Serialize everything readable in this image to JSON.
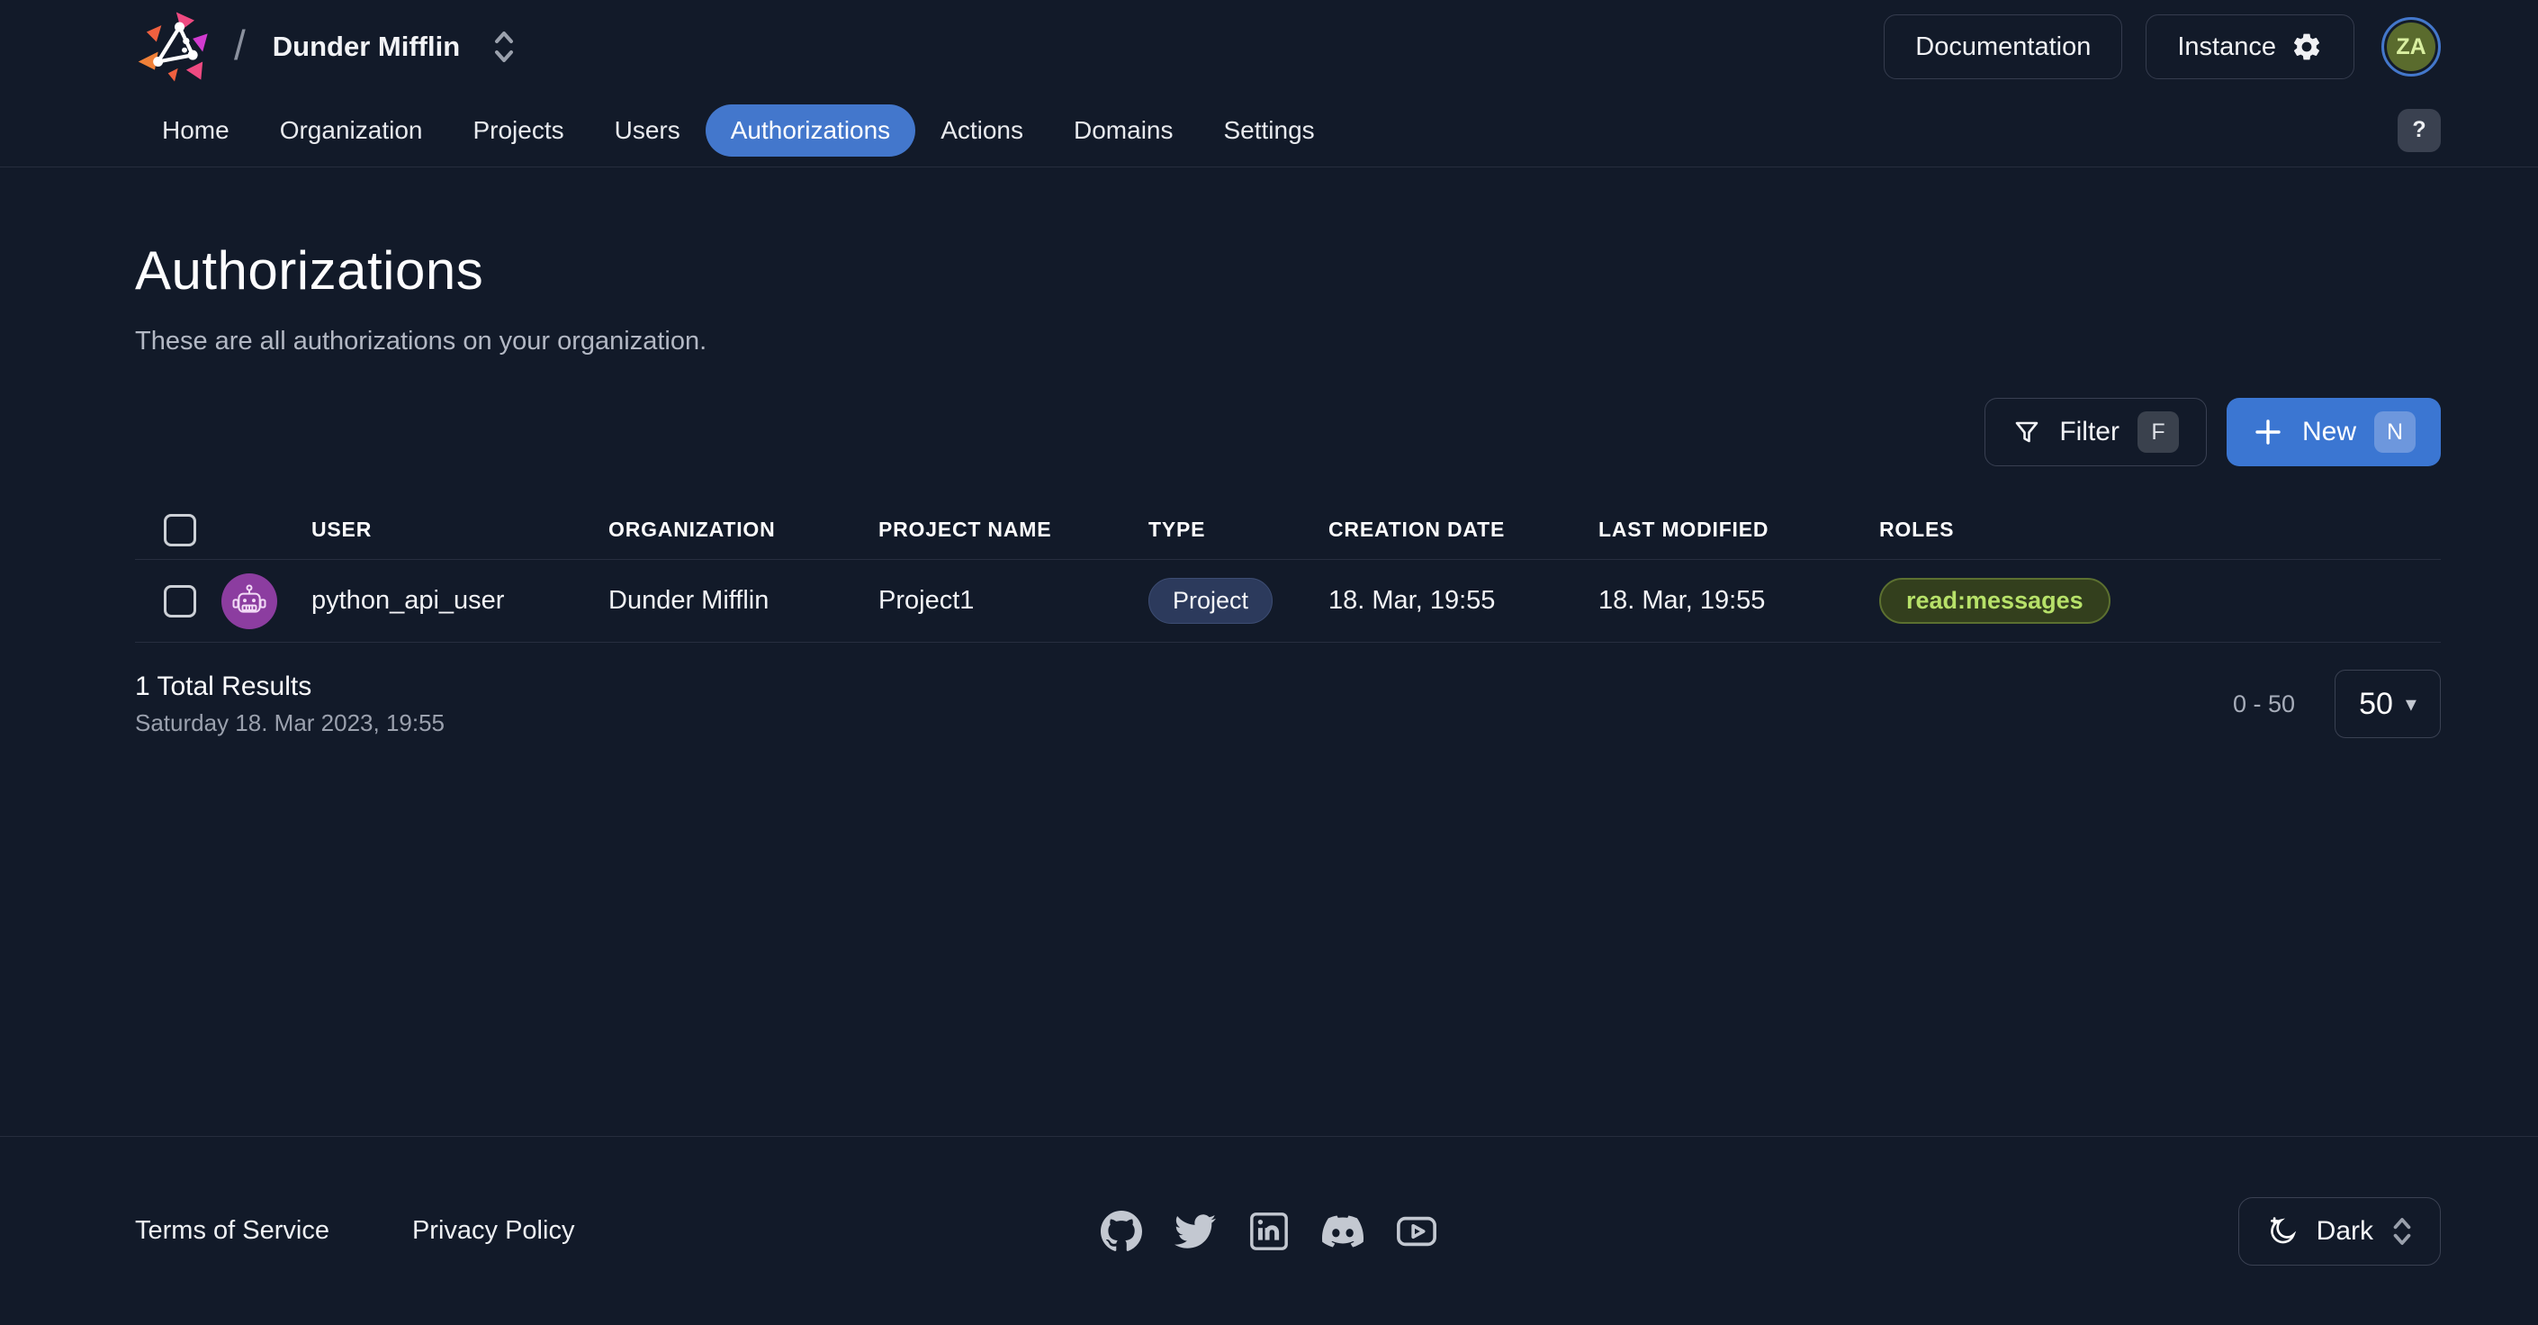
{
  "header": {
    "org_name": "Dunder Mifflin",
    "documentation_label": "Documentation",
    "instance_label": "Instance",
    "avatar_initials": "ZA"
  },
  "nav": {
    "items": [
      {
        "label": "Home",
        "active": false
      },
      {
        "label": "Organization",
        "active": false
      },
      {
        "label": "Projects",
        "active": false
      },
      {
        "label": "Users",
        "active": false
      },
      {
        "label": "Authorizations",
        "active": true
      },
      {
        "label": "Actions",
        "active": false
      },
      {
        "label": "Domains",
        "active": false
      },
      {
        "label": "Settings",
        "active": false
      }
    ],
    "help_label": "?"
  },
  "page": {
    "title": "Authorizations",
    "subtitle": "These are all authorizations on your organization."
  },
  "toolbar": {
    "filter_label": "Filter",
    "filter_shortcut": "F",
    "new_label": "New",
    "new_shortcut": "N"
  },
  "table": {
    "columns": [
      "USER",
      "ORGANIZATION",
      "PROJECT NAME",
      "TYPE",
      "CREATION DATE",
      "LAST MODIFIED",
      "ROLES"
    ],
    "rows": [
      {
        "user": "python_api_user",
        "organization": "Dunder Mifflin",
        "project_name": "Project1",
        "type": "Project",
        "creation_date": "18. Mar, 19:55",
        "last_modified": "18. Mar, 19:55",
        "roles": [
          "read:messages"
        ]
      }
    ]
  },
  "results": {
    "total_label": "1 Total Results",
    "timestamp": "Saturday 18. Mar 2023, 19:55",
    "range": "0 - 50",
    "page_size": "50"
  },
  "footer": {
    "links": [
      "Terms of Service",
      "Privacy Policy"
    ],
    "social_icons": [
      "github",
      "twitter",
      "linkedin",
      "discord",
      "youtube"
    ],
    "theme_label": "Dark"
  },
  "colors": {
    "background": "#121a29",
    "accent_blue": "#4377cc",
    "new_button_blue": "#3b76d2",
    "role_badge_text": "#b7e169",
    "robot_avatar_purple": "#8c3da0",
    "user_avatar_olive": "#5a6b2d",
    "border": "#262d3d"
  }
}
